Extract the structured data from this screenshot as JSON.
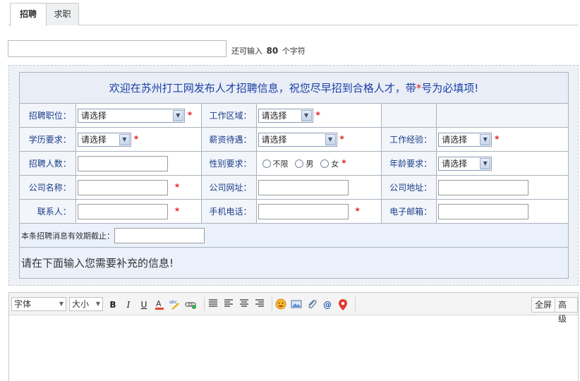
{
  "tabs": [
    {
      "label": "招聘",
      "active": true
    },
    {
      "label": "求职",
      "active": false
    }
  ],
  "title_input": {
    "value": "",
    "hint_prefix": "还可输入",
    "remaining": "80",
    "hint_suffix": "个字符"
  },
  "form": {
    "header_text_a": "欢迎在苏州打工网发布人才招聘信息，祝您尽早招到合格人才，带",
    "header_star": "*",
    "header_text_b": "号为必填项!",
    "required_mark": "*",
    "rows": [
      [
        {
          "label": "招聘职位：",
          "value": "请选择",
          "type": "select",
          "required": true
        },
        {
          "label": "工作区域：",
          "value": "请选择",
          "type": "select",
          "required": true
        },
        {
          "label": "",
          "value": "",
          "type": "empty",
          "required": false
        }
      ],
      [
        {
          "label": "学历要求：",
          "value": "请选择",
          "type": "select",
          "required": true
        },
        {
          "label": "薪资待遇：",
          "value": "请选择",
          "type": "select",
          "required": true
        },
        {
          "label": "工作经验：",
          "value": "请选择",
          "type": "select",
          "required": true
        }
      ],
      [
        {
          "label": "招聘人数：",
          "value": "",
          "type": "text",
          "required": false
        },
        {
          "label": "性别要求：",
          "type": "radio",
          "options": [
            "不限",
            "男",
            "女"
          ],
          "required": true
        },
        {
          "label": "年龄要求：",
          "value": "请选择",
          "type": "select",
          "required": false
        }
      ],
      [
        {
          "label": "公司名称：",
          "value": "",
          "type": "text",
          "required": true
        },
        {
          "label": "公司网址：",
          "value": "",
          "type": "text",
          "required": false
        },
        {
          "label": "公司地址：",
          "value": "",
          "type": "text",
          "required": false
        }
      ],
      [
        {
          "label": "联系人：",
          "value": "",
          "type": "text",
          "required": true
        },
        {
          "label": "手机电话：",
          "value": "",
          "type": "text",
          "required": true
        },
        {
          "label": "电子邮箱：",
          "value": "",
          "type": "text",
          "required": false
        }
      ]
    ],
    "expiry_label": "本条招聘消息有效期截止：",
    "expiry_value": "",
    "extra_info": "请在下面输入您需要补充的信息!"
  },
  "editor": {
    "font_select": "字体",
    "size_select": "大小",
    "buttons": [
      "B",
      "I",
      "U"
    ],
    "fullscreen_label": "全屏",
    "advanced_label": "高级",
    "content": ""
  },
  "colors": {
    "accent_blue": "#1b3fa6",
    "required_red": "#e21c1c",
    "panel_bg": "#eef1f6"
  }
}
